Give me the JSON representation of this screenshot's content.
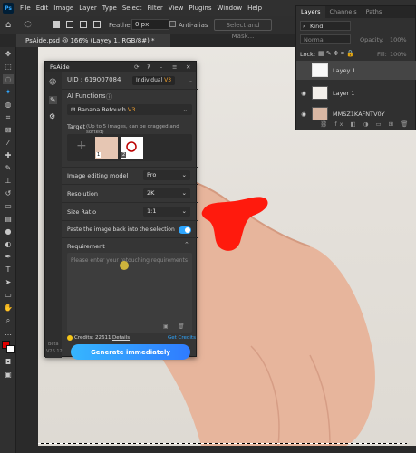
{
  "menubar": {
    "items": [
      "File",
      "Edit",
      "Image",
      "Layer",
      "Type",
      "Select",
      "Filter",
      "View",
      "Plugins",
      "Window",
      "Help"
    ]
  },
  "options": {
    "feather_label": "Feather:",
    "feather_value": "0 px",
    "antialias_label": "Anti-alias",
    "select_mask_label": "Select and Mask..."
  },
  "doc_tab": {
    "title": "PsAide.psd @ 166% (Layey 1, RGB/8#) *"
  },
  "layers_panel": {
    "tabs": [
      "Layers",
      "Channels",
      "Paths"
    ],
    "kind_label": "Kind",
    "blend_mode": "Normal",
    "opacity_label": "Opacity:",
    "opacity_value": "100%",
    "lock_label": "Lock:",
    "fill_label": "Fill:",
    "fill_value": "100%",
    "layers": [
      {
        "name": "Layey 1"
      },
      {
        "name": "Layer 1"
      },
      {
        "name": "MMSZ1KAFNTV0Y"
      }
    ]
  },
  "psaide": {
    "title": "PsAide",
    "uid": "UID : 619007084",
    "plan_badge": "Individual",
    "plan_version": "V3",
    "ai_functions_label": "AI Functions",
    "function_value": "Banana Retouch",
    "function_version": "V3",
    "target_label": "Target",
    "target_hint": "(Up to 5 images, can be dragged and sorted)",
    "thumb_numbers": [
      "1",
      "2"
    ],
    "model_label": "Image editing model",
    "model_value": "Pro",
    "resolution_label": "Resolution",
    "resolution_value": "2K",
    "size_label": "Size Ratio",
    "size_value": "1:1",
    "paste_label": "Paste the image back into the selection",
    "requirement_label": "Requirement",
    "requirement_placeholder": "Please enter your retouching requirements",
    "credits_label": "Credits: 22611",
    "details_label": "Details",
    "get_credits_label": "Get Credits",
    "generate_label": "Generate immediately",
    "side_beta": "Beta",
    "side_version": "V26.12"
  },
  "colors": {
    "accent": "#2ea6ff",
    "red_mark": "#ff1a0d",
    "foreground": "#e00000",
    "background_swatch": "#ffffff"
  }
}
